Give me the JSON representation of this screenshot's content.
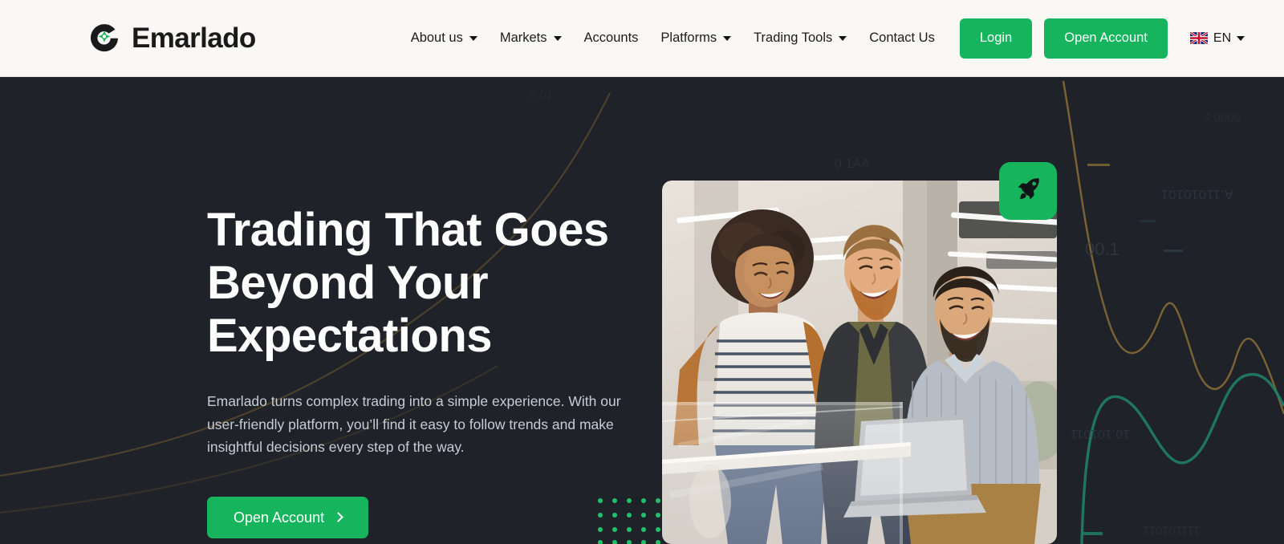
{
  "brand": {
    "name": "Emarlado",
    "logo_icon": "emarlado-ring-star-logo",
    "accent_color": "#16b45c",
    "header_bg": "#f9f8f5",
    "hero_bg": "#1f2329"
  },
  "header": {
    "nav": [
      {
        "label": "About us",
        "has_dropdown": true,
        "icon": "chevron-down-icon"
      },
      {
        "label": "Markets",
        "has_dropdown": true,
        "icon": "chevron-down-icon"
      },
      {
        "label": "Accounts",
        "has_dropdown": false,
        "icon": ""
      },
      {
        "label": "Platforms",
        "has_dropdown": true,
        "icon": "chevron-down-icon"
      },
      {
        "label": "Trading Tools",
        "has_dropdown": true,
        "icon": "chevron-down-icon"
      },
      {
        "label": "Contact Us",
        "has_dropdown": false,
        "icon": ""
      }
    ],
    "login_label": "Login",
    "open_account_label": "Open Account",
    "language": {
      "code": "EN",
      "flag_icon": "uk-flag-icon",
      "caret_icon": "chevron-down-icon"
    }
  },
  "hero": {
    "title": "Trading That Goes Beyond Your Expectations",
    "title_lines": [
      "Trading That Goes",
      "Beyond Your",
      "Expectations"
    ],
    "subtitle": "Emarlado turns complex trading into a simple experience. With our user-friendly platform, you’ll find it easy to follow trends and make insightful decisions every step of the way.",
    "cta_label": "Open Account",
    "cta_icon": "chevron-right-icon",
    "badge_icon": "rocket-icon",
    "photo_alt": "three-colleagues-smiling-at-laptop-in-office",
    "decor": {
      "dot_grid_icon": "green-dot-grid",
      "dot_color": "#1fc46a",
      "curve_gold": "#8a6b33",
      "curve_teal": "#1f6e5c"
    }
  }
}
